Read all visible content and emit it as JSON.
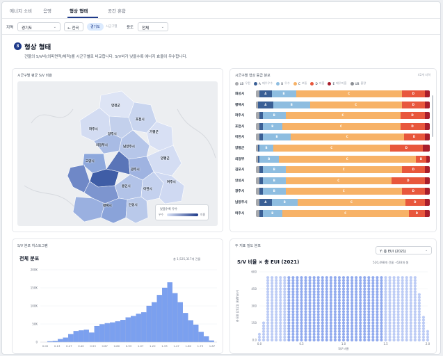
{
  "tabs": [
    {
      "label": "에너지 소비",
      "active": false
    },
    {
      "label": "음영",
      "active": false
    },
    {
      "label": "형상 형태",
      "active": true
    },
    {
      "label": "공간 혼합",
      "active": false
    }
  ],
  "filters": {
    "region_label": "지역",
    "region_value": "경기도",
    "back_label": "← 전국",
    "region_chip": "경기도",
    "breadcrumb": "시군구별",
    "usage_label": "용도",
    "usage_value": "전체"
  },
  "section": {
    "number": "3",
    "title": "형상 형태",
    "description": "건물의 S/V비(외피면적/체적)를 시군구별로 비교합니다. S/V비가 낮을수록 에너지 효율이 우수합니다."
  },
  "map_card": {
    "title": "시군구별 평균 S/V 비율",
    "cities": [
      "연천군",
      "포천시",
      "파주시",
      "양주시",
      "가평군",
      "의정부시",
      "남양주시",
      "고양시",
      "양평군",
      "광주시",
      "여주시",
      "용인시",
      "이천시",
      "안성시",
      "평택시"
    ],
    "legend_title": "낮을수록 우수",
    "legend_low": "우수",
    "legend_high": "미흡",
    "colors": {
      "low": "#dbe3f6",
      "high": "#1e3a8a"
    }
  },
  "grade_card": {
    "title": "시군구별 형상 등급 분포",
    "note": "42개 지역",
    "legend": [
      {
        "code": "LB",
        "sub": "우편",
        "color": "#a7a9ad"
      },
      {
        "code": "A",
        "sub": "매우우수",
        "color": "#3a5f95"
      },
      {
        "code": "B",
        "sub": "우수",
        "color": "#8ebde0"
      },
      {
        "code": "C",
        "sub": "보통",
        "color": "#f7b267"
      },
      {
        "code": "D",
        "sub": "미흡",
        "color": "#e8573c"
      },
      {
        "code": "E",
        "sub": "매우미흡",
        "color": "#a81d2b"
      },
      {
        "code": "UB",
        "sub": "불량",
        "color": "#8a8d93"
      }
    ],
    "rows": [
      {
        "name": "화성시",
        "shares": [
          0.02,
          0.07,
          0.14,
          0.61,
          0.13,
          0.03
        ]
      },
      {
        "name": "평택시",
        "shares": [
          0.01,
          0.09,
          0.21,
          0.53,
          0.13,
          0.03
        ]
      },
      {
        "name": "파주시",
        "shares": [
          0.02,
          0.02,
          0.13,
          0.66,
          0.14,
          0.03
        ]
      },
      {
        "name": "포천시",
        "shares": [
          0.02,
          0.02,
          0.11,
          0.68,
          0.14,
          0.03
        ]
      },
      {
        "name": "이천시",
        "shares": [
          0.02,
          0.02,
          0.16,
          0.65,
          0.12,
          0.03
        ]
      },
      {
        "name": "양평군",
        "shares": [
          0.01,
          0.01,
          0.08,
          0.67,
          0.19,
          0.04
        ]
      },
      {
        "name": "의정부",
        "shares": [
          0.01,
          0.01,
          0.11,
          0.79,
          0.06,
          0.02
        ]
      },
      {
        "name": "김포시",
        "shares": [
          0.02,
          0.02,
          0.13,
          0.67,
          0.13,
          0.03
        ]
      },
      {
        "name": "안성시",
        "shares": [
          0.02,
          0.02,
          0.13,
          0.61,
          0.19,
          0.03
        ]
      },
      {
        "name": "광주시",
        "shares": [
          0.02,
          0.02,
          0.13,
          0.67,
          0.13,
          0.03
        ]
      },
      {
        "name": "남양주시",
        "shares": [
          0.02,
          0.07,
          0.15,
          0.62,
          0.11,
          0.03
        ]
      },
      {
        "name": "여주시",
        "shares": [
          0.02,
          0.02,
          0.11,
          0.73,
          0.09,
          0.03
        ]
      }
    ]
  },
  "hist_card": {
    "title": "S/V 분포 히스토그램",
    "chart_title": "전체 분포",
    "note": "총 1,525,317개 건물"
  },
  "scatter_card": {
    "title": "두 지표 밀도 분포",
    "select_value": "Y: 총 EUI (2021)",
    "chart_title": "S/V 비율 × 총 EUI (2021)",
    "note": "520,498개 건물 · 628개 셀"
  },
  "chart_data": [
    {
      "type": "bar",
      "title": "전체 분포",
      "xlabel": "",
      "ylabel": "",
      "x_ticks": [
        "0.00",
        "0.13",
        "0.27",
        "0.40",
        "0.53",
        "0.67",
        "0.80",
        "0.93",
        "1.07",
        "1.20",
        "1.33",
        "1.47",
        "1.60",
        "1.73",
        "1.87"
      ],
      "y_ticks": [
        "0",
        "50K",
        "100K",
        "150K",
        "200K"
      ],
      "ylim": [
        0,
        200000
      ],
      "bin_start": 0.0,
      "bin_end": 1.87,
      "values": [
        2000,
        3000,
        8000,
        12000,
        22000,
        30000,
        32000,
        34000,
        26000,
        44000,
        49000,
        52000,
        54000,
        57000,
        61000,
        68000,
        72000,
        78000,
        82000,
        100000,
        110000,
        130000,
        150000,
        165000,
        135000,
        110000,
        80000,
        60000,
        48000,
        28000,
        16000,
        4000
      ]
    },
    {
      "type": "scatter",
      "title": "S/V 비율 × 총 EUI (2021)",
      "xlabel": "S/V 비율",
      "ylabel": "총 EUI (2021) (kWh/m²)",
      "xlim": [
        0.0,
        2.0
      ],
      "ylim": [
        0,
        600
      ],
      "x_ticks": [
        "0.0",
        "0.5",
        "1.0",
        "1.5",
        "2.0"
      ],
      "y_ticks": [
        "0.0",
        "150",
        "300",
        "450",
        "600"
      ],
      "cols_x": [
        0.0,
        0.05,
        0.1,
        0.15,
        0.2,
        0.25,
        0.3,
        0.35,
        0.4,
        0.45,
        0.5,
        0.55,
        0.6,
        0.65,
        0.7,
        0.75,
        0.8,
        0.85,
        0.9,
        0.95,
        1.0,
        1.05,
        1.1,
        1.15,
        1.2,
        1.25,
        1.3,
        1.35,
        1.4,
        1.45,
        1.5,
        1.55,
        1.6,
        1.65,
        1.7,
        1.75,
        1.8,
        1.85,
        1.9,
        1.95,
        2.0
      ],
      "cols_top": [
        50,
        150,
        560,
        560,
        560,
        560,
        560,
        560,
        560,
        560,
        560,
        560,
        560,
        560,
        560,
        560,
        560,
        560,
        560,
        560,
        560,
        560,
        560,
        560,
        560,
        560,
        560,
        560,
        560,
        560,
        560,
        560,
        560,
        560,
        560,
        560,
        560,
        560,
        420,
        200,
        80
      ],
      "row_step": 25
    }
  ]
}
